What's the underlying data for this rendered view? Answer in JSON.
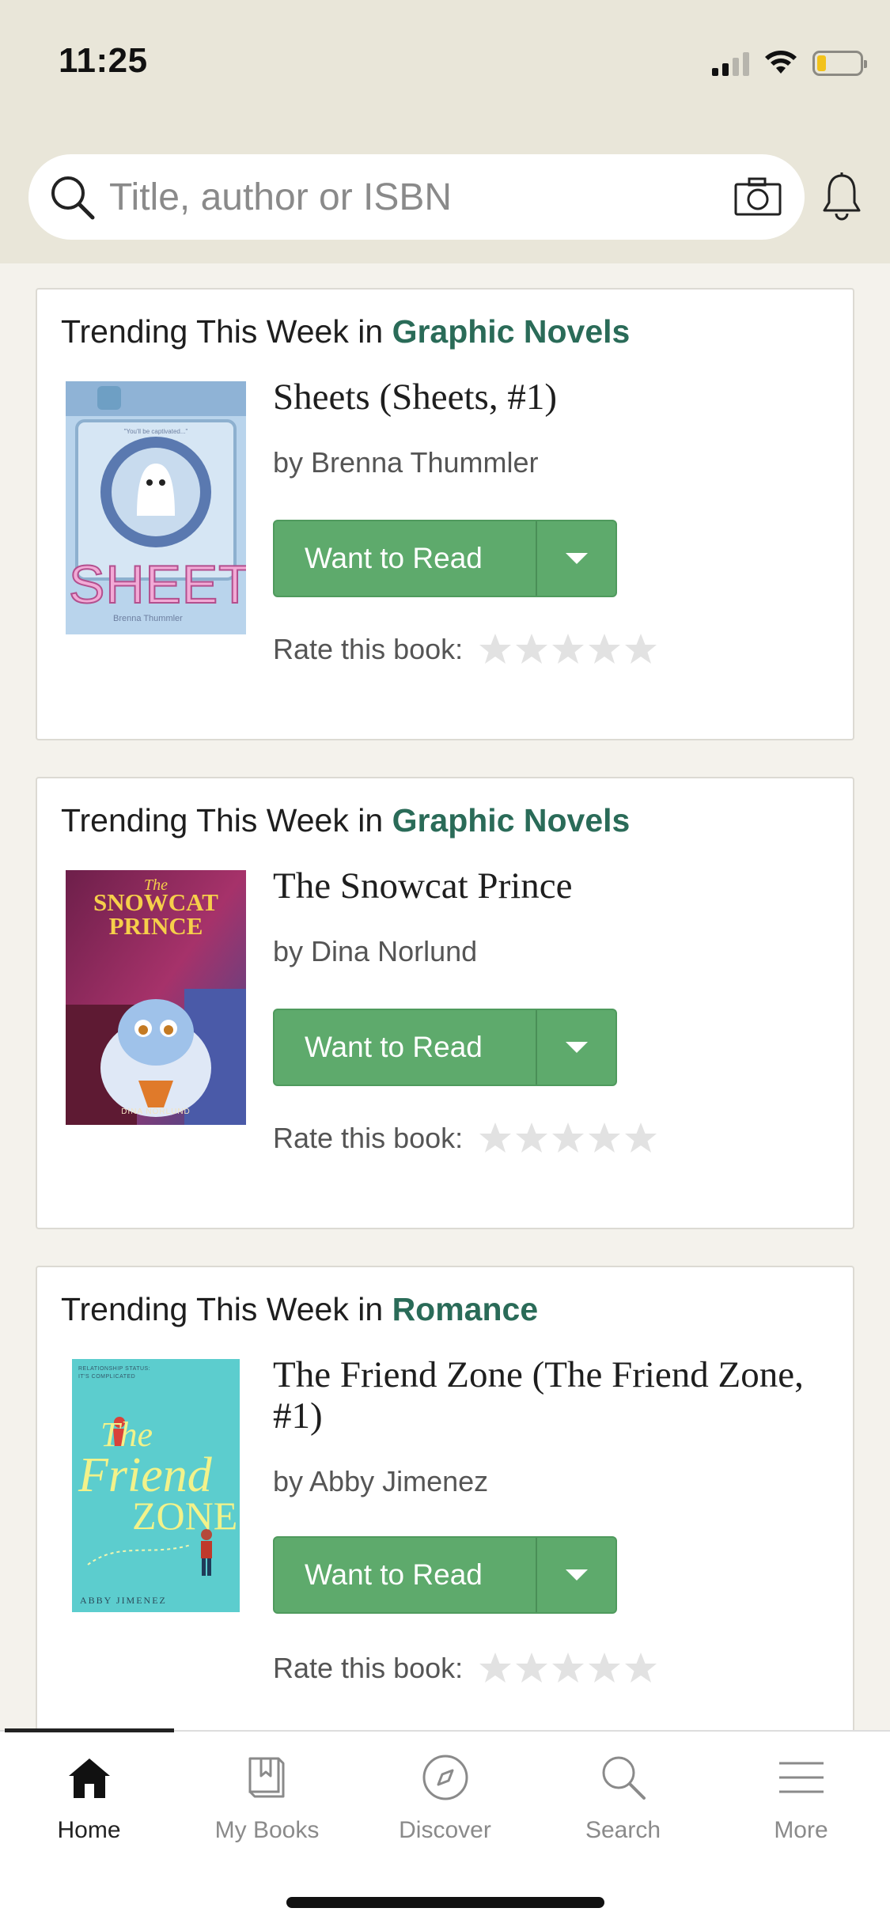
{
  "status_bar": {
    "time": "11:25"
  },
  "search": {
    "placeholder": "Title, author or ISBN"
  },
  "cards": [
    {
      "heading_prefix": "Trending This Week in ",
      "genre": "Graphic Novels",
      "title": "Sheets (Sheets, #1)",
      "author": "by Brenna Thummler",
      "button_label": "Want to Read",
      "rate_label": "Rate this book:",
      "cover_text": "SHEETS",
      "cover_blurb": "\"You'll be captivated...\"",
      "cover_author": "Brenna Thummler"
    },
    {
      "heading_prefix": "Trending This Week in ",
      "genre": "Graphic Novels",
      "title": "The Snowcat Prince",
      "author": "by Dina Norlund",
      "button_label": "Want to Read",
      "rate_label": "Rate this book:",
      "cover_the": "The",
      "cover_title_1": "SNOWCAT",
      "cover_title_2": "PRINCE",
      "cover_author": "DINA NORLUND"
    },
    {
      "heading_prefix": "Trending This Week in ",
      "genre": "Romance",
      "title": "The Friend Zone (The Friend Zone, #1)",
      "author": "by Abby Jimenez",
      "button_label": "Want to Read",
      "rate_label": "Rate this book:",
      "cover_tag_1": "RELATIONSHIP STATUS:",
      "cover_tag_2": "IT'S COMPLICATED",
      "cover_the": "The",
      "cover_friend": "Friend",
      "cover_zone": "ZONE",
      "cover_author": "ABBY JIMENEZ"
    }
  ],
  "tabs": [
    {
      "label": "Home",
      "icon": "home-icon",
      "active": true
    },
    {
      "label": "My Books",
      "icon": "my-books-icon",
      "active": false
    },
    {
      "label": "Discover",
      "icon": "compass-icon",
      "active": false
    },
    {
      "label": "Search",
      "icon": "search-icon",
      "active": false
    },
    {
      "label": "More",
      "icon": "menu-icon",
      "active": false
    }
  ],
  "colors": {
    "header_bg": "#e9e6d9",
    "genre_link": "#2a6b58",
    "button_green": "#5eaa6c",
    "star_empty": "#e2e2e2"
  }
}
